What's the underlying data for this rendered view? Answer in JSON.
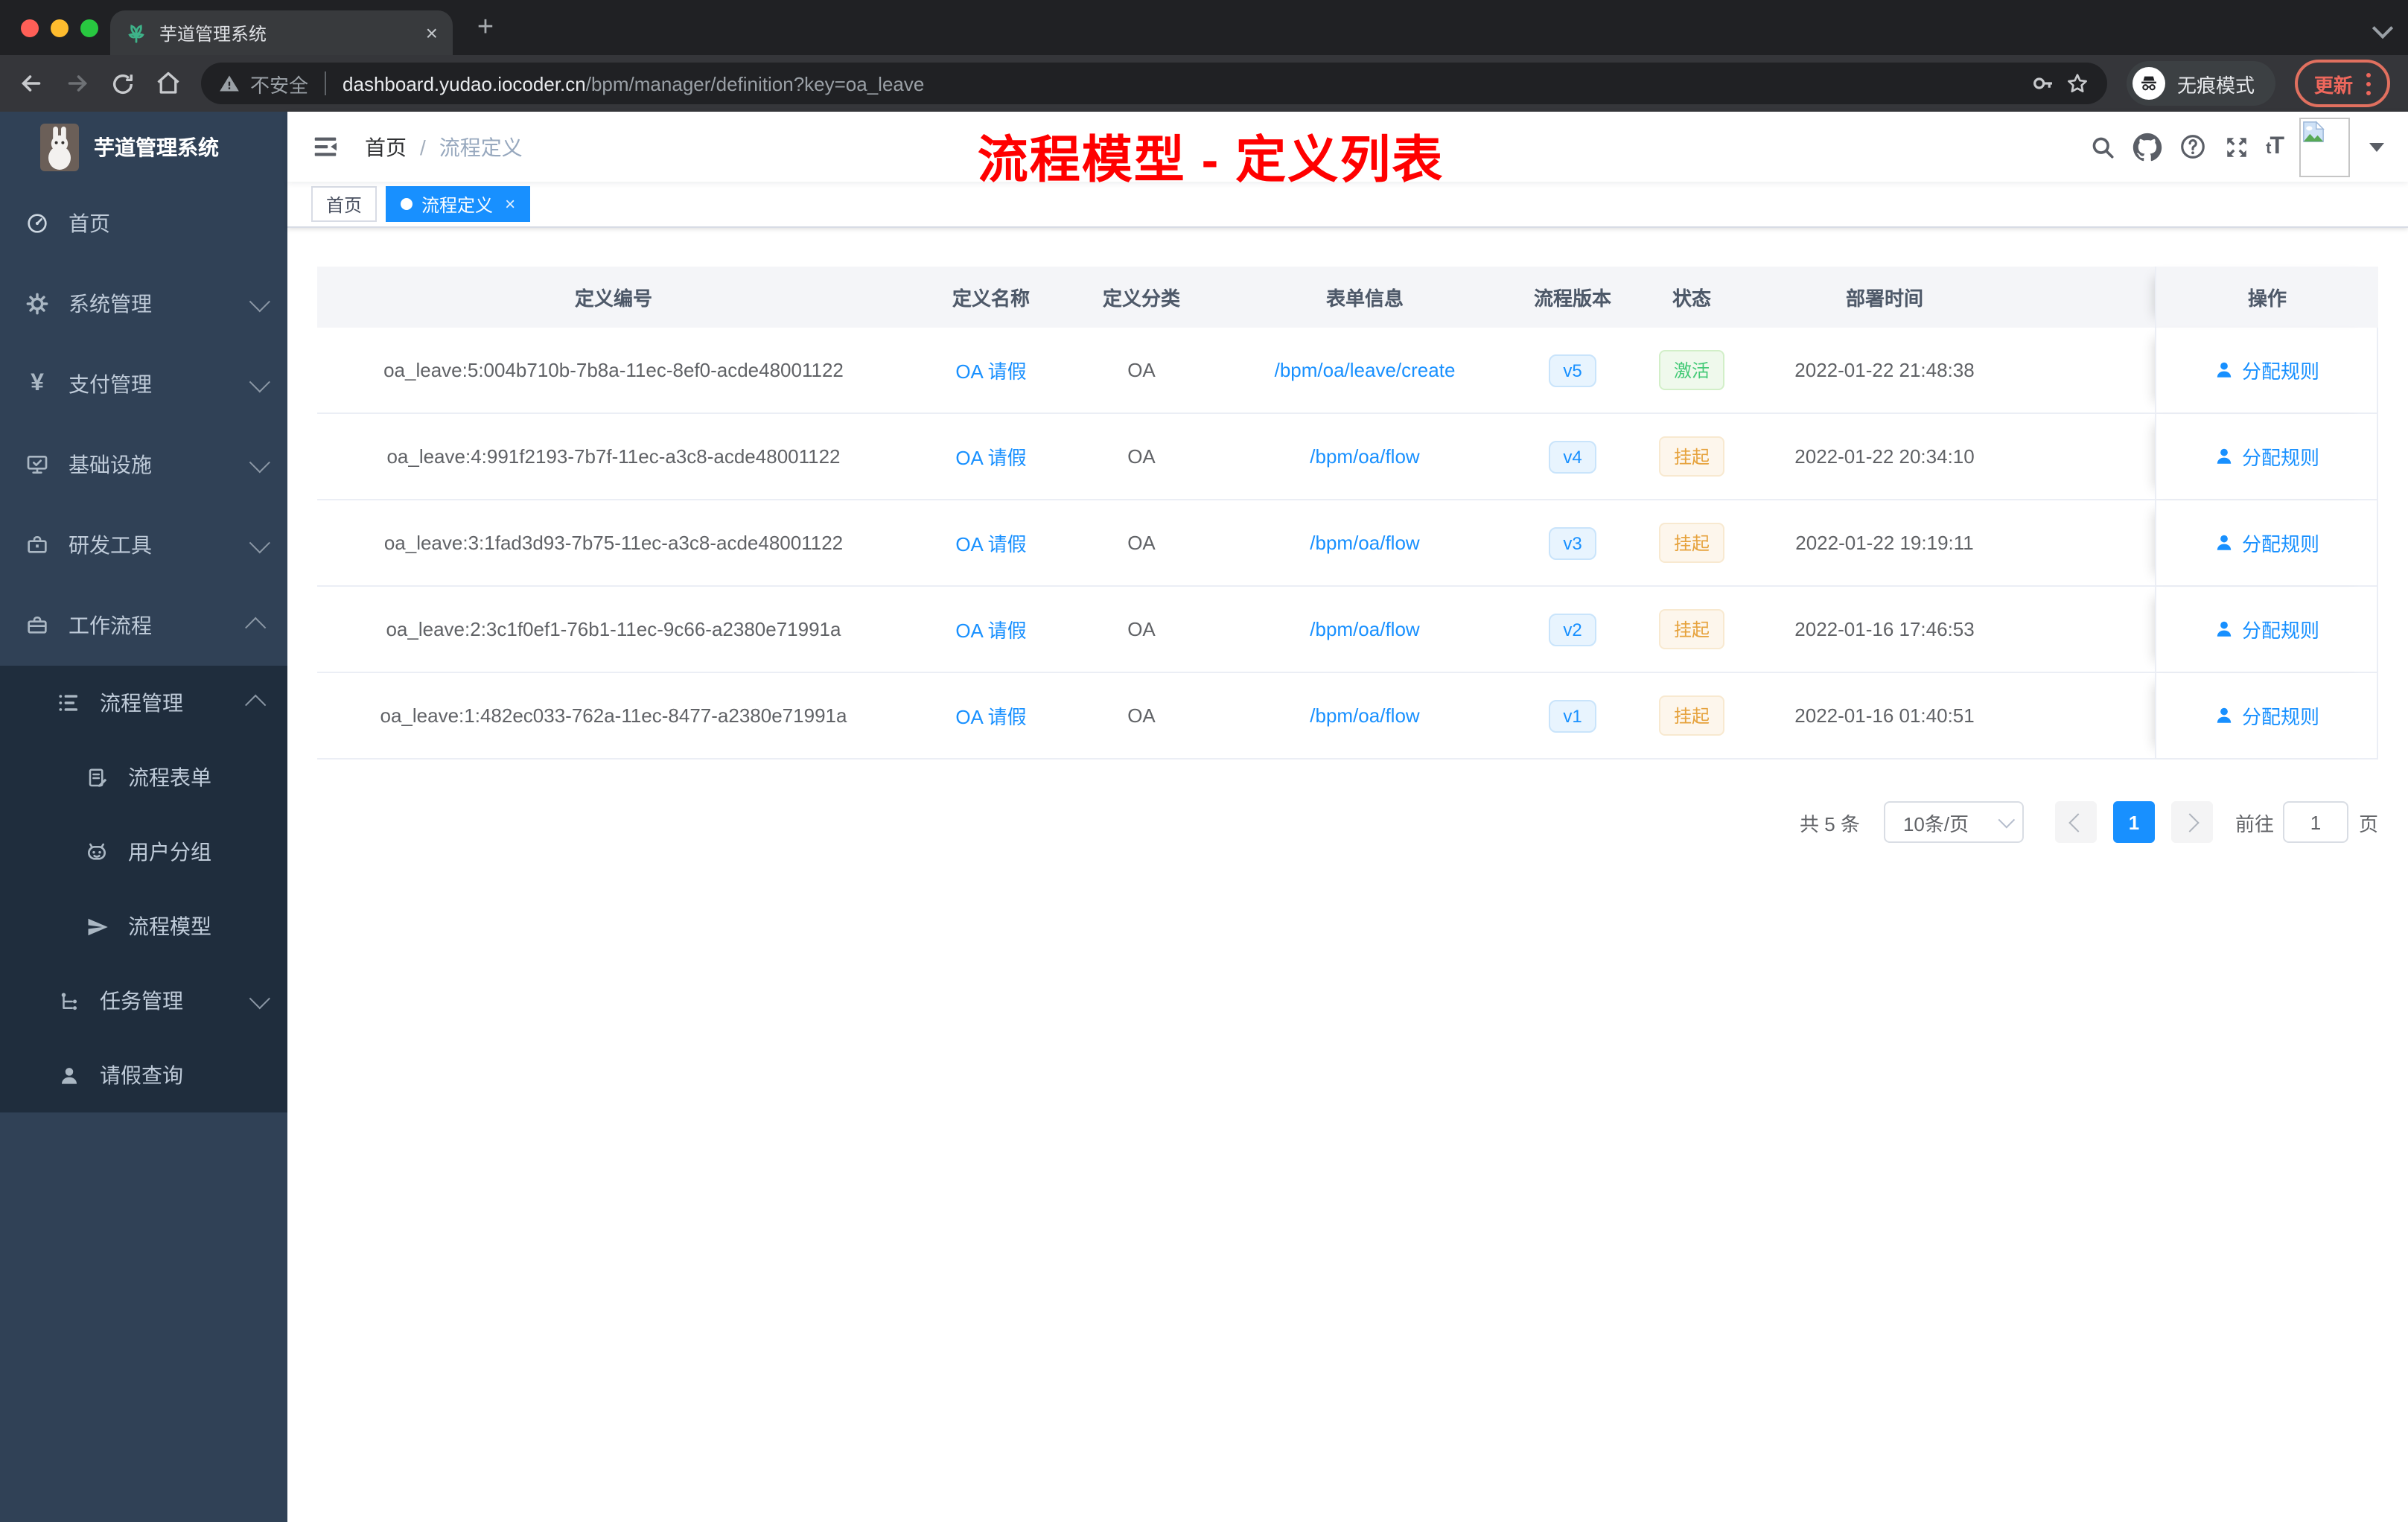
{
  "browser": {
    "tab": {
      "title": "芋道管理系统",
      "close_glyph": "×",
      "new_tab_glyph": "+"
    },
    "traffic_colors": {
      "close": "#ff5f57",
      "minimize": "#febc2e",
      "zoom": "#28c840"
    },
    "toolbar": {
      "security_label": "不安全",
      "url_host": "dashboard.yudao.iocoder.cn",
      "url_path": "/bpm/manager/definition?key=oa_leave",
      "incognito_label": "无痕模式",
      "update_label": "更新"
    }
  },
  "sidebar": {
    "brand": "芋道管理系统",
    "menu": [
      {
        "label": "首页",
        "icon": "dashboard-icon"
      },
      {
        "label": "系统管理",
        "icon": "gear-icon",
        "expand": "down"
      },
      {
        "label": "支付管理",
        "icon": "yen-icon",
        "expand": "down"
      },
      {
        "label": "基础设施",
        "icon": "monitor-icon",
        "expand": "down"
      },
      {
        "label": "研发工具",
        "icon": "toolbox-icon",
        "expand": "down"
      },
      {
        "label": "工作流程",
        "icon": "briefcase-icon",
        "expand": "up"
      }
    ],
    "submenu": [
      {
        "label": "流程管理",
        "icon": "flow-list-icon",
        "expand": "up"
      },
      {
        "label": "流程表单",
        "icon": "form-icon"
      },
      {
        "label": "用户分组",
        "icon": "robot-icon"
      },
      {
        "label": "流程模型",
        "icon": "send-icon"
      },
      {
        "label": "任务管理",
        "icon": "tree-icon",
        "expand": "down"
      },
      {
        "label": "请假查询",
        "icon": "user-icon"
      }
    ]
  },
  "navbar": {
    "breadcrumb": [
      "首页",
      "流程定义"
    ],
    "breadcrumb_separator": "/",
    "annotation_title": "流程模型 - 定义列表",
    "fontsize_icon_text": "tT"
  },
  "tags": {
    "home": "首页",
    "active": "流程定义",
    "active_close": "×"
  },
  "table": {
    "columns": [
      "定义编号",
      "定义名称",
      "定义分类",
      "表单信息",
      "流程版本",
      "状态",
      "部署时间",
      "操作"
    ],
    "action_label": "分配规则",
    "rows": [
      {
        "id": "oa_leave:5:004b710b-7b8a-11ec-8ef0-acde48001122",
        "name": "OA 请假",
        "category": "OA",
        "form": "/bpm/oa/leave/create",
        "version": "v5",
        "status": "激活",
        "time": "2022-01-22 21:48:38"
      },
      {
        "id": "oa_leave:4:991f2193-7b7f-11ec-a3c8-acde48001122",
        "name": "OA 请假",
        "category": "OA",
        "form": "/bpm/oa/flow",
        "version": "v4",
        "status": "挂起",
        "time": "2022-01-22 20:34:10"
      },
      {
        "id": "oa_leave:3:1fad3d93-7b75-11ec-a3c8-acde48001122",
        "name": "OA 请假",
        "category": "OA",
        "form": "/bpm/oa/flow",
        "version": "v3",
        "status": "挂起",
        "time": "2022-01-22 19:19:11"
      },
      {
        "id": "oa_leave:2:3c1f0ef1-76b1-11ec-9c66-a2380e71991a",
        "name": "OA 请假",
        "category": "OA",
        "form": "/bpm/oa/flow",
        "version": "v2",
        "status": "挂起",
        "time": "2022-01-16 17:46:53"
      },
      {
        "id": "oa_leave:1:482ec033-762a-11ec-8477-a2380e71991a",
        "name": "OA 请假",
        "category": "OA",
        "form": "/bpm/oa/flow",
        "version": "v1",
        "status": "挂起",
        "time": "2022-01-16 01:40:51"
      }
    ]
  },
  "pagination": {
    "total_label": "共 5 条",
    "page_size_label": "10条/页",
    "current_page": "1",
    "goto_label": "前往",
    "goto_value": "1",
    "unit_label": "页"
  },
  "colors": {
    "primary": "#1890ff",
    "success": "#42c975",
    "warning": "#e6a23c",
    "sidebar_bg": "#304156",
    "submenu_bg": "#1f2d3d",
    "annotation": "#ff0000"
  }
}
